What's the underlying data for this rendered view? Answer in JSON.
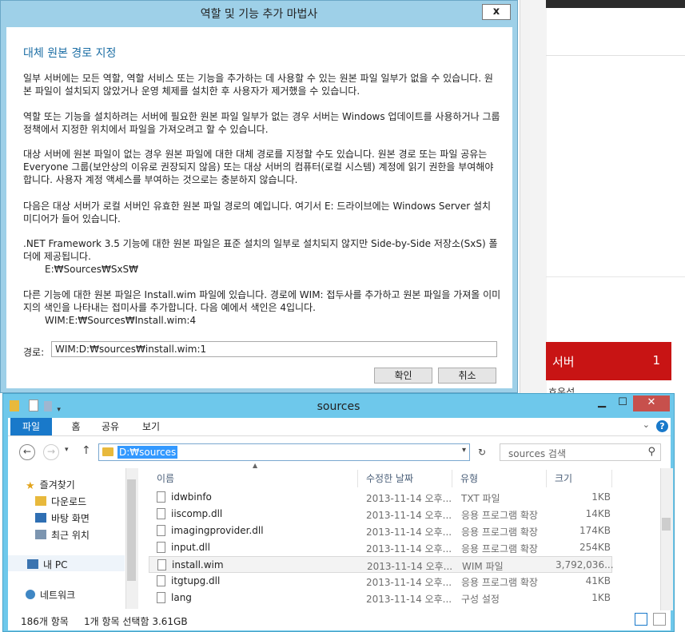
{
  "server_manager": {
    "tile_label": "서버",
    "tile_count": "1",
    "sub_label": "호운성"
  },
  "wizard": {
    "title": "역할 및 기능 추가 마법사",
    "close": "x",
    "heading": "대체 원본 경로 지정",
    "para1": "일부 서버에는 모든 역할, 역할 서비스 또는 기능을 추가하는 데 사용할 수 있는 원본 파일 일부가 없을 수 있습니다. 원본 파일이 설치되지 않았거나 운영 체제를 설치한 후 사용자가 제거했을 수 있습니다.",
    "para2": "역할 또는 기능을 설치하려는 서버에 필요한 원본 파일 일부가 없는 경우 서버는 Windows 업데이트를 사용하거나 그룹 정책에서 지정한 위치에서 파일을 가져오려고 할 수 있습니다.",
    "para3": "대상 서버에 원본 파일이 없는 경우 원본 파일에 대한 대체 경로를 지정할 수도 있습니다. 원본 경로 또는 파일 공유는 Everyone 그룹(보안상의 이유로 권장되지 않음) 또는 대상 서버의 컴퓨터(로컬 시스템) 계정에 읽기 권한을 부여해야 합니다. 사용자 계정 액세스를 부여하는 것으로는 충분하지 않습니다.",
    "para4": "다음은 대상 서버가 로컬 서버인 유효한 원본 파일 경로의 예입니다. 여기서 E: 드라이브에는 Windows Server 설치 미디어가 들어 있습니다.",
    "para5": ".NET Framework 3.5 기능에 대한 원본 파일은 표준 설치의 일부로 설치되지 않지만 Side-by-Side 저장소(SxS) 폴더에 제공됩니다.",
    "path1": "E:₩Sources₩SxS₩",
    "para6": "다른 기능에 대한 원본 파일은 Install.wim 파일에 있습니다. 경로에 WIM: 접두사를 추가하고 원본 파일을 가져올 이미지의 색인을 나타내는 접미사를 추가합니다. 다음 예에서 색인은 4입니다.",
    "path2": "WIM:E:₩Sources₩Install.wim:4",
    "path_label": "경로:",
    "path_value": "WIM:D:₩sources₩install.wim:1",
    "ok": "확인",
    "cancel": "취소"
  },
  "explorer": {
    "title": "sources",
    "min": "▁",
    "max": "☐",
    "close": "✕",
    "tabs": {
      "file": "파일",
      "home": "홈",
      "share": "공유",
      "view": "보기"
    },
    "help": "?",
    "address": "D:₩sources",
    "search_placeholder": "sources 검색",
    "nav": {
      "favorites": "즐겨찾기",
      "downloads": "다운로드",
      "desktop": "바탕 화면",
      "recent": "최근 위치",
      "this_pc": "내 PC",
      "network": "네트워크"
    },
    "columns": {
      "name": "이름",
      "modified": "수정한 날짜",
      "type": "유형",
      "size": "크기"
    },
    "files": [
      {
        "name": "idwbinfo",
        "date": "2013-11-14 오후...",
        "type": "TXT 파일",
        "size": "1KB"
      },
      {
        "name": "iiscomp.dll",
        "date": "2013-11-14 오후...",
        "type": "응용 프로그램 확장",
        "size": "14KB"
      },
      {
        "name": "imagingprovider.dll",
        "date": "2013-11-14 오후...",
        "type": "응용 프로그램 확장",
        "size": "174KB"
      },
      {
        "name": "input.dll",
        "date": "2013-11-14 오후...",
        "type": "응용 프로그램 확장",
        "size": "254KB"
      },
      {
        "name": "install.wim",
        "date": "2013-11-14 오후...",
        "type": "WIM 파일",
        "size": "3,792,036..."
      },
      {
        "name": "itgtupg.dll",
        "date": "2013-11-14 오후...",
        "type": "응용 프로그램 확장",
        "size": "41KB"
      },
      {
        "name": "lang",
        "date": "2013-11-14 오후...",
        "type": "구성 설정",
        "size": "1KB"
      }
    ],
    "status_count": "186개 항목",
    "status_selection": "1개 항목 선택함 3.61GB"
  }
}
